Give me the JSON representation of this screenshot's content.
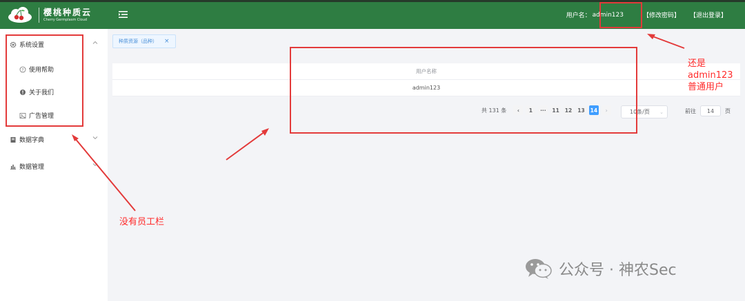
{
  "header": {
    "logo_title": "樱桃种质云",
    "logo_subtitle": "Cherry Germplasm Cloud",
    "username_label": "用户名：",
    "username": "admin123",
    "change_password": "【修改密码】",
    "logout": "【退出登录】",
    "bg_color": "#2e7d42"
  },
  "sidebar": {
    "items": [
      {
        "label": "系统设置",
        "icon": "gear-icon"
      },
      {
        "label": "使用帮助",
        "icon": "help-circle-icon"
      },
      {
        "label": "关于我们",
        "icon": "info-circle-icon"
      },
      {
        "label": "广告管理",
        "icon": "image-icon"
      },
      {
        "label": "数据字典",
        "icon": "book-icon"
      },
      {
        "label": "数据管理",
        "icon": "bar-chart-icon"
      }
    ]
  },
  "tabs": [
    {
      "label": "种质资源（品种）"
    }
  ],
  "table": {
    "columns": [
      "用户名称"
    ],
    "rows": [
      [
        "admin123"
      ]
    ]
  },
  "pagination": {
    "total": "共 131 条",
    "pages": [
      "1",
      "···",
      "11",
      "12",
      "13",
      "14"
    ],
    "current": "14",
    "page_size": "10条/页",
    "goto_label": "前往",
    "goto_value": "14",
    "goto_suffix": "页"
  },
  "annotations": {
    "right_note": [
      "还是",
      "admin123",
      "普通用户"
    ],
    "left_note": "没有员工栏",
    "color": "#e33a3a"
  },
  "watermark": {
    "text": "公众号 · 神农Sec"
  }
}
